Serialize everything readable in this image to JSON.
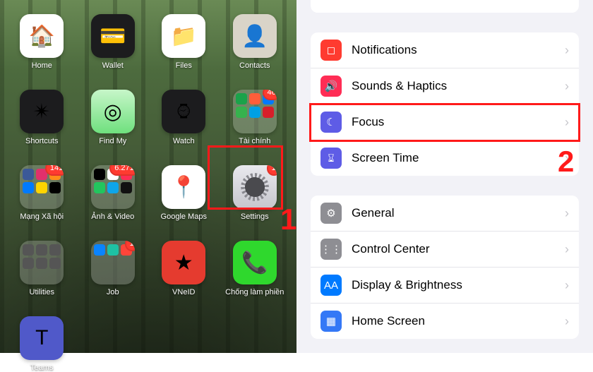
{
  "annotations": {
    "step1": "1",
    "step2": "2",
    "highlight_left": "Settings",
    "highlight_right": "Focus"
  },
  "homescreen": {
    "apps": [
      {
        "label": "Home",
        "kind": "single",
        "icon": "ic-home",
        "glyph": "🏠"
      },
      {
        "label": "Wallet",
        "kind": "single",
        "icon": "ic-wallet",
        "glyph": "💳"
      },
      {
        "label": "Files",
        "kind": "single",
        "icon": "ic-files",
        "glyph": "📁"
      },
      {
        "label": "Contacts",
        "kind": "single",
        "icon": "ic-contacts",
        "glyph": "👤"
      },
      {
        "label": "Shortcuts",
        "kind": "single",
        "icon": "ic-shortcuts",
        "glyph": "✴︎"
      },
      {
        "label": "Find My",
        "kind": "single",
        "icon": "ic-findmy",
        "glyph": "◎"
      },
      {
        "label": "Watch",
        "kind": "single",
        "icon": "ic-watch",
        "glyph": "⌚︎"
      },
      {
        "label": "Tài chính",
        "kind": "folder",
        "badge": "46",
        "minis": [
          "#1aa34a",
          "#ff5e3a",
          "#007aff",
          "#36b24d",
          "#00a0e4",
          "#d71f2a"
        ]
      },
      {
        "label": "Mạng Xã hội",
        "kind": "folder",
        "badge": "141",
        "minis": [
          "#3b5998",
          "#e1306c",
          "#ff8c1a",
          "#007aff",
          "#ffd400",
          "#000"
        ]
      },
      {
        "label": "Ảnh & Video",
        "kind": "folder",
        "badge": "6.271",
        "minis": [
          "#000",
          "#fff",
          "#ff2d55",
          "#22c55e",
          "#0ea5e9",
          "#111"
        ]
      },
      {
        "label": "Google Maps",
        "kind": "single",
        "icon": "ic-maps",
        "glyph": "📍"
      },
      {
        "label": "Settings",
        "kind": "single",
        "icon": "ic-settings",
        "glyph": "gear",
        "badge": "1"
      },
      {
        "label": "Utilities",
        "kind": "folder",
        "minis": [
          "#555",
          "#555",
          "#555",
          "#555",
          "#555",
          "#555"
        ]
      },
      {
        "label": "Job",
        "kind": "folder",
        "badge": "1",
        "minis": [
          "#0a84ff",
          "#1ec1a3",
          "#ff453a"
        ]
      },
      {
        "label": "VNeID",
        "kind": "single",
        "icon": "ic-vneid",
        "glyph": "★"
      },
      {
        "label": "Chống làm phiền",
        "kind": "single",
        "icon": "ic-chong",
        "glyph": "📞"
      },
      {
        "label": "Teams",
        "kind": "single",
        "icon": "ic-teams",
        "glyph": "T"
      }
    ]
  },
  "settings": {
    "groups": [
      {
        "rows": [
          {
            "title": "Notifications",
            "icon": "si-notif",
            "glyph": "◻︎"
          },
          {
            "title": "Sounds & Haptics",
            "icon": "si-sound",
            "glyph": "🔊"
          },
          {
            "title": "Focus",
            "icon": "si-focus",
            "glyph": "☾"
          },
          {
            "title": "Screen Time",
            "icon": "si-screentime",
            "glyph": "⌛︎"
          }
        ]
      },
      {
        "rows": [
          {
            "title": "General",
            "icon": "si-general",
            "glyph": "⚙︎"
          },
          {
            "title": "Control Center",
            "icon": "si-control",
            "glyph": "⋮⋮"
          },
          {
            "title": "Display & Brightness",
            "icon": "si-display",
            "glyph": "AA"
          },
          {
            "title": "Home Screen",
            "icon": "si-homescreen",
            "glyph": "▦"
          }
        ]
      }
    ]
  }
}
